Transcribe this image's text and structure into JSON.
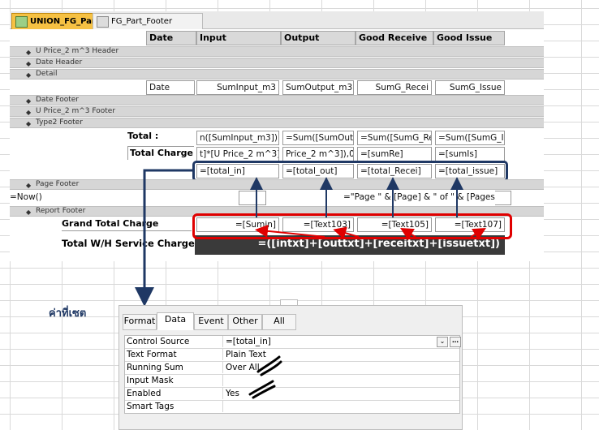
{
  "tabs": [
    {
      "label": "UNION_FG_Part"
    },
    {
      "label": "FG_Part_Footer"
    }
  ],
  "columns": [
    "Date",
    "Input",
    "Output",
    "Good Receive",
    "Good Issue"
  ],
  "sections": {
    "u_price_header": "U Price_2 m^3 Header",
    "date_header": "Date Header",
    "detail": "Detail",
    "date_footer": "Date Footer",
    "u_price_footer": "U Price_2 m^3 Footer",
    "type2_footer": "Type2 Footer",
    "page_footer": "Page Footer",
    "report_footer": "Report Footer"
  },
  "detail_fields": [
    "Date",
    "SumInput_m3",
    "SumOutput_m3",
    "SumG_Recei",
    "SumG_Issue"
  ],
  "type2": {
    "total_label": "Total :",
    "total_charge_label": "Total Charge :",
    "total_row": [
      "n([SumInput_m3])",
      "=Sum([SumOutp",
      "=Sum([SumG_Rec",
      "=Sum([SumG_Is"
    ],
    "charge_row": [
      "t]*[U Price_2 m^3]",
      "Price_2 m^3]),0)",
      "=[sumRe]",
      "=[sumIs]"
    ],
    "highlight_row": [
      "=[total_in]",
      "=[total_out]",
      "=[total_Recei]",
      "=[total_issue]"
    ]
  },
  "page_footer": {
    "now": "=Now()",
    "page_expr": "=\"Page \" & [Page] & \" of \" & [Pages]"
  },
  "report_footer": {
    "grand_total_label": "Grand Total Charge",
    "grand_fields": [
      "=[Sumin]",
      "=[Text103]",
      "=[Text105]",
      "=[Text107]"
    ],
    "wh_label": "Total W/H Service Charge :",
    "wh_expr": "=([intxt]+[outtxt]+[receitxt]+[issuetxt])"
  },
  "annotation_label": "ค่าที่เซต",
  "property_sheet": {
    "tabs": [
      "Format",
      "Data",
      "Event",
      "Other",
      "All"
    ],
    "active_tab": "Data",
    "rows": [
      {
        "key": "Control Source",
        "value": "=[total_in]"
      },
      {
        "key": "Text Format",
        "value": "Plain Text"
      },
      {
        "key": "Running Sum",
        "value": "Over All"
      },
      {
        "key": "Input Mask",
        "value": ""
      },
      {
        "key": "Enabled",
        "value": "Yes"
      },
      {
        "key": "Smart Tags",
        "value": ""
      }
    ]
  },
  "colors": {
    "highlight_red": "#e00000",
    "highlight_navy": "#1f3864",
    "active_tab": "#f6c143"
  }
}
